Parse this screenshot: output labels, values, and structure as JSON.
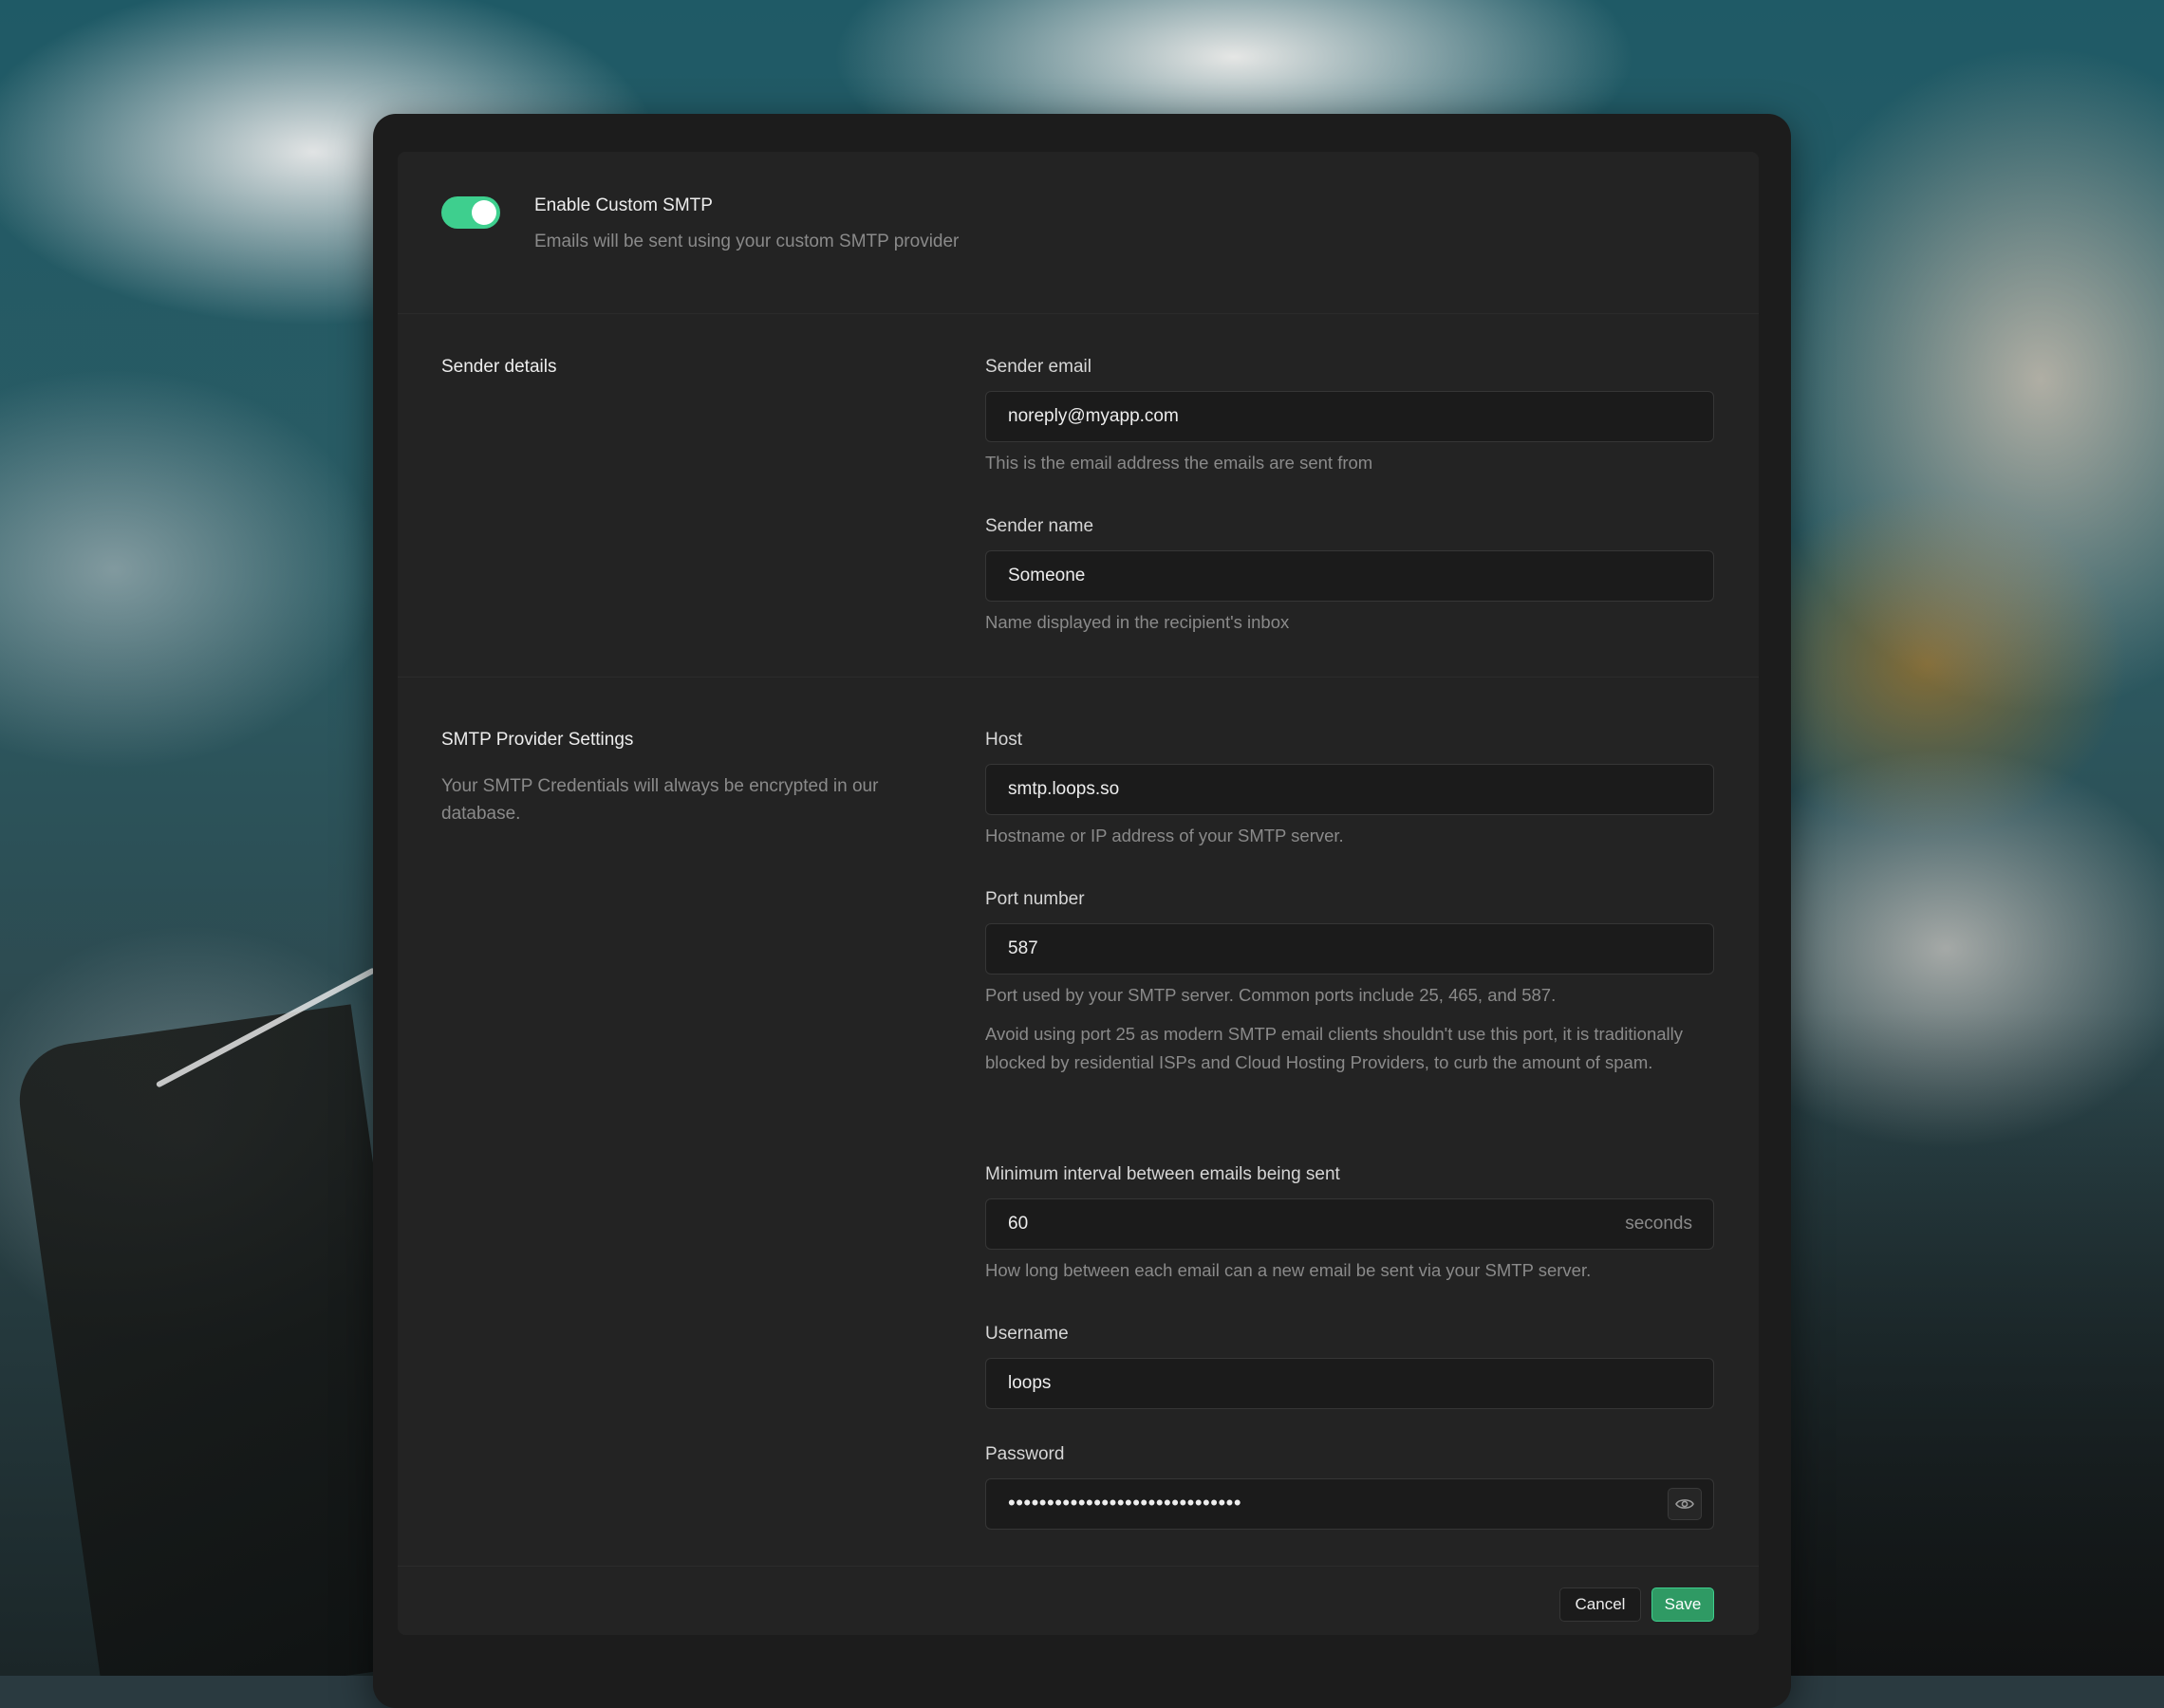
{
  "smtp_toggle": {
    "enabled": true,
    "title": "Enable Custom SMTP",
    "description": "Emails will be sent using your custom SMTP provider"
  },
  "sender_details": {
    "title": "Sender details",
    "sender_email": {
      "label": "Sender email",
      "value": "noreply@myapp.com",
      "help": "This is the email address the emails are sent from"
    },
    "sender_name": {
      "label": "Sender name",
      "value": "Someone",
      "help": "Name displayed in the recipient's inbox"
    }
  },
  "smtp_provider": {
    "title": "SMTP Provider Settings",
    "description": "Your SMTP Credentials will always be encrypted in our database.",
    "host": {
      "label": "Host",
      "value": "smtp.loops.so",
      "help": "Hostname or IP address of your SMTP server."
    },
    "port": {
      "label": "Port number",
      "value": "587",
      "help": "Port used by your SMTP server. Common ports include 25, 465, and 587.",
      "help_2": "Avoid using port 25 as modern SMTP email clients shouldn't use this port, it is traditionally blocked by residential ISPs and Cloud Hosting Providers, to curb the amount of spam."
    },
    "interval": {
      "label": "Minimum interval between emails being sent",
      "value": "60",
      "suffix": "seconds",
      "help": "How long between each email can a new email be sent via your SMTP server."
    },
    "username": {
      "label": "Username",
      "value": "loops"
    },
    "password": {
      "label": "Password",
      "masked_value": "••••••••••••••••••••••••••••••",
      "reveal_icon": "eye-icon"
    }
  },
  "footer": {
    "cancel_label": "Cancel",
    "save_label": "Save"
  },
  "colors": {
    "accent": "#3ecf8e",
    "save_button": "#2f9a64",
    "panel": "#232323",
    "input_bg": "#1b1b1b"
  }
}
